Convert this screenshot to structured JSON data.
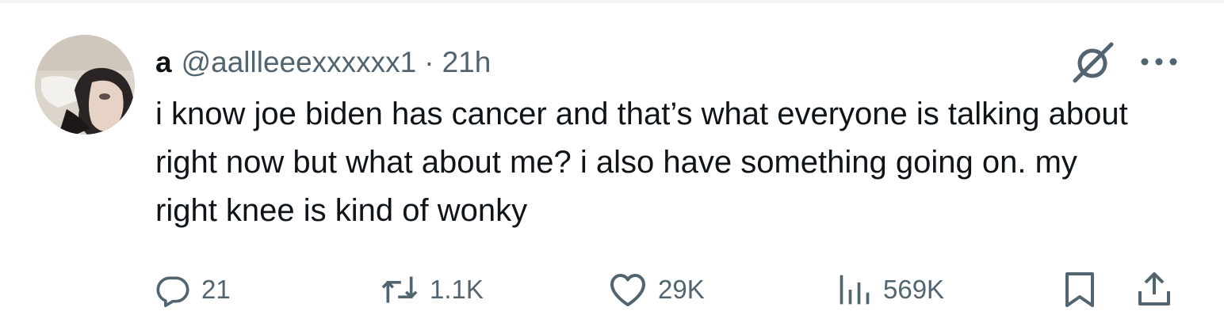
{
  "tweet": {
    "author": {
      "display_name": "a",
      "handle": "@aallleeexxxxxx1",
      "separator": "·",
      "time": "21h"
    },
    "text": "i know joe biden has cancer and that’s what everyone is talking about right now but what about me? i also have something going on. my right knee is kind of wonky",
    "metrics": {
      "replies": "21",
      "reposts": "1.1K",
      "likes": "29K",
      "views": "569K"
    }
  },
  "icons": {
    "grok": "grok-icon",
    "more": "more-icon",
    "reply": "reply-icon",
    "repost": "repost-icon",
    "like": "like-icon",
    "views": "views-icon",
    "bookmark": "bookmark-icon",
    "share": "share-icon"
  },
  "colors": {
    "text_primary": "#0f1419",
    "text_secondary": "#536471",
    "divider": "#eff3f4"
  }
}
